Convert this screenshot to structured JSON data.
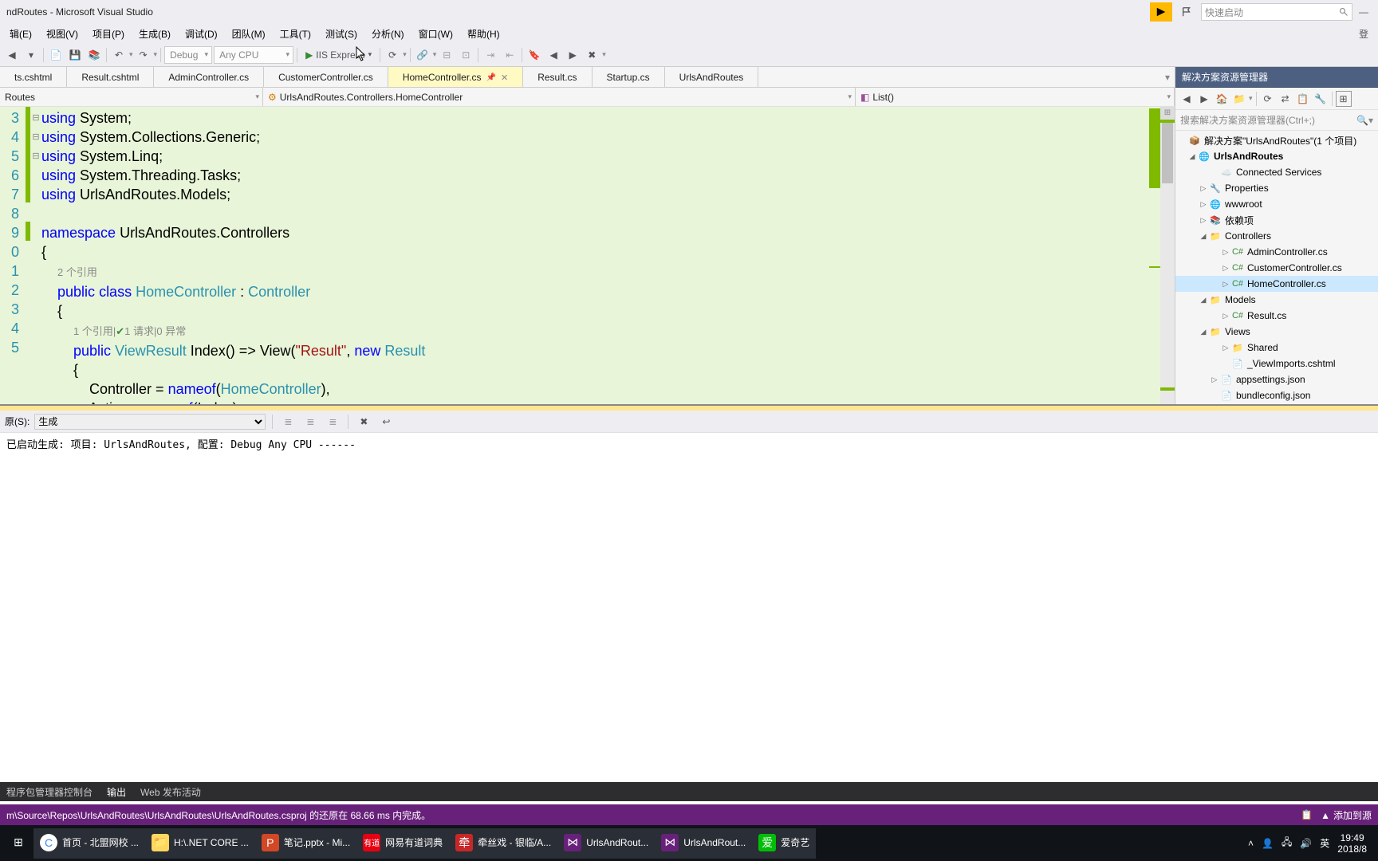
{
  "title": "ndRoutes - Microsoft Visual Studio",
  "quicklaunch_placeholder": "快速启动",
  "menu": [
    "辑(E)",
    "视图(V)",
    "项目(P)",
    "生成(B)",
    "调试(D)",
    "团队(M)",
    "工具(T)",
    "测试(S)",
    "分析(N)",
    "窗口(W)",
    "帮助(H)"
  ],
  "login_label": "登",
  "toolbar": {
    "debug": "Debug",
    "cpu": "Any CPU",
    "iis": "IIS Express"
  },
  "tabs": [
    "ts.cshtml",
    "Result.cshtml",
    "AdminController.cs",
    "CustomerController.cs",
    "HomeController.cs",
    "Result.cs",
    "Startup.cs",
    "UrlsAndRoutes"
  ],
  "active_tab_index": 4,
  "nav": {
    "ns": "Routes",
    "class": "UrlsAndRoutes.Controllers.HomeController",
    "member": "List()"
  },
  "gutter": [
    "",
    "3",
    "4",
    "5",
    "6",
    "7",
    "8",
    "9",
    "0",
    "1",
    "",
    "2",
    "3",
    "4",
    "5"
  ],
  "codelens1": "2 个引用",
  "codelens2_a": "1 个引用",
  "codelens2_b": "1 请求",
  "codelens2_c": "0 异常",
  "sidebar": {
    "title": "解决方案资源管理器",
    "search_placeholder": "搜索解决方案资源管理器(Ctrl+;)",
    "solution": "解决方案\"UrlsAndRoutes\"(1 个项目)",
    "project": "UrlsAndRoutes",
    "items": {
      "connected": "Connected Services",
      "properties": "Properties",
      "wwwroot": "wwwroot",
      "deps": "依赖项",
      "controllers": "Controllers",
      "admin": "AdminController.cs",
      "customer": "CustomerController.cs",
      "home": "HomeController.cs",
      "models": "Models",
      "result": "Result.cs",
      "views": "Views",
      "shared": "Shared",
      "viewimports": "_ViewImports.cshtml",
      "appsettings": "appsettings.json",
      "bundle": "bundleconfig.json"
    }
  },
  "output": {
    "source_label": "原(S):",
    "source_value": "生成",
    "text": "已启动生成: 项目: UrlsAndRoutes, 配置: Debug Any CPU ------",
    "tabs": [
      "程序包管理器控制台",
      "输出",
      "Web 发布活动"
    ]
  },
  "status": {
    "text": "m\\Source\\Repos\\UrlsAndRoutes\\UrlsAndRoutes\\UrlsAndRoutes.csproj 的还原在 68.66 ms 内完成。",
    "add": "添加到源"
  },
  "taskbar": {
    "items": [
      {
        "icon": "⊞",
        "label": "",
        "color": "#fff"
      },
      {
        "icon": "C",
        "label": "首页 - 北盟网校 ...",
        "color": "#fff",
        "bg": "#4285f4"
      },
      {
        "icon": "📁",
        "label": "H:\\.NET CORE ...",
        "color": "#000",
        "bg": "#ffd75e"
      },
      {
        "icon": "P",
        "label": "笔记.pptx - Mi...",
        "color": "#fff",
        "bg": "#d24726"
      },
      {
        "icon": "有道",
        "label": "网易有道词典",
        "color": "#fff",
        "bg": "#e60012"
      },
      {
        "icon": "牵",
        "label": "牵丝戏 - 银临/A...",
        "color": "#fff",
        "bg": "#c62828"
      },
      {
        "icon": "⋈",
        "label": "UrlsAndRout...",
        "color": "#fff",
        "bg": "#68217a"
      },
      {
        "icon": "⋈",
        "label": "UrlsAndRout...",
        "color": "#fff",
        "bg": "#68217a"
      },
      {
        "icon": "爱",
        "label": "爱奇艺",
        "color": "#fff",
        "bg": "#00be06"
      }
    ],
    "tray_time": "19:49",
    "tray_date": "2018/8",
    "tray_ime": "英"
  }
}
